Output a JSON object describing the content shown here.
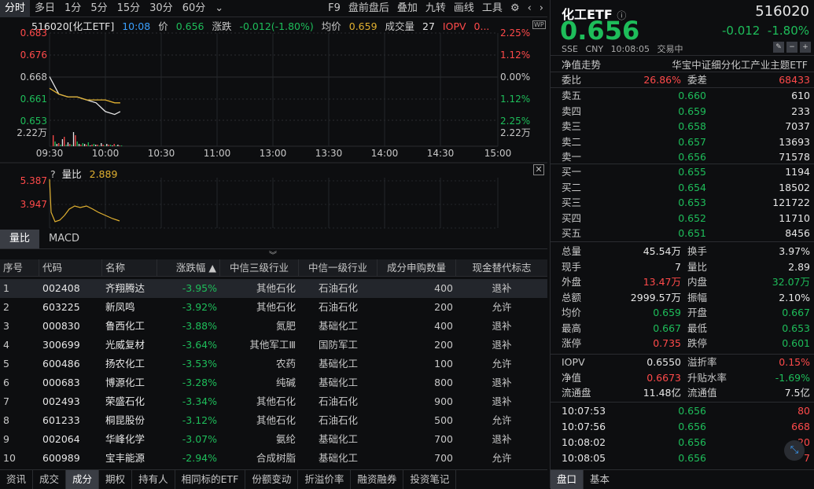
{
  "toolbar": {
    "timeframes": [
      "分时",
      "多日",
      "1分",
      "5分",
      "15分",
      "30分",
      "60分"
    ],
    "more": "⌄",
    "tools": [
      "F9",
      "盘前盘后",
      "叠加",
      "九转",
      "画线",
      "工具"
    ]
  },
  "quote_line": {
    "name": "516020[化工ETF]",
    "time": "10:08",
    "price_label": "价",
    "price": "0.656",
    "chg_label": "涨跌",
    "chg": "-0.012(-1.80%)",
    "avg_label": "均价",
    "avg": "0.659",
    "vol_label": "成交量",
    "vol": "27",
    "iopv_label": "IOPV",
    "iopv": "0..."
  },
  "price_axis": {
    "left": [
      "0.683",
      "0.676",
      "0.668",
      "0.661",
      "0.653",
      "2.22万"
    ],
    "right": [
      "2.25%",
      "1.12%",
      "0.00%",
      "1.12%",
      "2.25%",
      "2.22万"
    ]
  },
  "time_axis": [
    "09:30",
    "10:00",
    "10:30",
    "11:00",
    "13:00",
    "13:30",
    "14:00",
    "14:30",
    "15:00"
  ],
  "sub": {
    "help": "?",
    "name": "量比",
    "value": "2.889",
    "axis": [
      "5.387",
      "3.947"
    ]
  },
  "panel_tabs": [
    "量比",
    "MACD"
  ],
  "table": {
    "headers": [
      "序号",
      "代码",
      "名称",
      "涨跌幅",
      "中信三级行业",
      "中信一级行业",
      "成分申购数量",
      "现金替代标志"
    ],
    "rows": [
      [
        "1",
        "002408",
        "齐翔腾达",
        "-3.95%",
        "其他石化",
        "石油石化",
        "400",
        "退补"
      ],
      [
        "2",
        "603225",
        "新凤鸣",
        "-3.92%",
        "其他石化",
        "石油石化",
        "200",
        "允许"
      ],
      [
        "3",
        "000830",
        "鲁西化工",
        "-3.88%",
        "氮肥",
        "基础化工",
        "400",
        "退补"
      ],
      [
        "4",
        "300699",
        "光威复材",
        "-3.64%",
        "其他军工Ⅲ",
        "国防军工",
        "200",
        "退补"
      ],
      [
        "5",
        "600486",
        "扬农化工",
        "-3.53%",
        "农药",
        "基础化工",
        "100",
        "允许"
      ],
      [
        "6",
        "000683",
        "博源化工",
        "-3.28%",
        "纯碱",
        "基础化工",
        "800",
        "退补"
      ],
      [
        "7",
        "002493",
        "荣盛石化",
        "-3.34%",
        "其他石化",
        "石油石化",
        "900",
        "退补"
      ],
      [
        "8",
        "601233",
        "桐昆股份",
        "-3.12%",
        "其他石化",
        "石油石化",
        "500",
        "允许"
      ],
      [
        "9",
        "002064",
        "华峰化学",
        "-3.07%",
        "氨纶",
        "基础化工",
        "700",
        "退补"
      ],
      [
        "10",
        "600989",
        "宝丰能源",
        "-2.94%",
        "合成树脂",
        "基础化工",
        "700",
        "允许"
      ]
    ]
  },
  "bottom_tabs": [
    "资讯",
    "成交",
    "成分",
    "期权",
    "持有人",
    "相同标的ETF",
    "份额变动",
    "折溢价率",
    "融资融券",
    "投资笔记"
  ],
  "right": {
    "name": "化工ETF",
    "code": "516020",
    "price": "0.656",
    "chg": "-0.012",
    "pct": "-1.80%",
    "meta": [
      "SSE",
      "CNY",
      "10:08:05",
      "交易中"
    ],
    "nav_trend": "净值走势",
    "full_name": "华宝中证细分化工产业主题ETF",
    "wb": {
      "l1": "委比",
      "v1": "26.86%",
      "l2": "委差",
      "v2": "68433"
    },
    "asks": [
      [
        "卖五",
        "0.660",
        "610"
      ],
      [
        "卖四",
        "0.659",
        "233"
      ],
      [
        "卖三",
        "0.658",
        "7037"
      ],
      [
        "卖二",
        "0.657",
        "13693"
      ],
      [
        "卖一",
        "0.656",
        "71578"
      ]
    ],
    "bids": [
      [
        "买一",
        "0.655",
        "1194"
      ],
      [
        "买二",
        "0.654",
        "18502"
      ],
      [
        "买三",
        "0.653",
        "121722"
      ],
      [
        "买四",
        "0.652",
        "11710"
      ],
      [
        "买五",
        "0.651",
        "8456"
      ]
    ],
    "stats": [
      [
        "总量",
        "45.54万",
        "换手",
        "3.97%"
      ],
      [
        "现手",
        "7",
        "量比",
        "2.89"
      ],
      [
        "外盘",
        "13.47万",
        "内盘",
        "32.07万"
      ],
      [
        "总额",
        "2999.57万",
        "振幅",
        "2.10%"
      ],
      [
        "均价",
        "0.659",
        "开盘",
        "0.667"
      ],
      [
        "最高",
        "0.667",
        "最低",
        "0.653"
      ],
      [
        "涨停",
        "0.735",
        "跌停",
        "0.601"
      ]
    ],
    "iopv": [
      [
        "IOPV",
        "0.6550",
        "溢折率",
        "0.15%"
      ],
      [
        "净值",
        "0.6673",
        "升贴水率",
        "-1.69%"
      ],
      [
        "流通盘",
        "11.48亿",
        "流通值",
        "7.5亿"
      ]
    ],
    "ticks": [
      [
        "10:07:53",
        "0.656",
        "80"
      ],
      [
        "10:07:56",
        "0.656",
        "668"
      ],
      [
        "10:08:02",
        "0.656",
        "20"
      ],
      [
        "10:08:05",
        "0.656",
        "7"
      ]
    ],
    "tabs": [
      "盘口",
      "基本"
    ]
  },
  "chart_data": {
    "type": "line",
    "title": "516020[化工ETF]",
    "x": [
      "09:30",
      "09:35",
      "09:40",
      "09:45",
      "09:50",
      "09:55",
      "10:00",
      "10:05",
      "10:08"
    ],
    "series": [
      {
        "name": "价",
        "values": [
          0.668,
          0.662,
          0.661,
          0.661,
          0.66,
          0.659,
          0.656,
          0.655,
          0.656
        ]
      },
      {
        "name": "均价",
        "values": [
          0.664,
          0.662,
          0.661,
          0.661,
          0.66,
          0.66,
          0.66,
          0.659,
          0.659
        ]
      }
    ],
    "ylim": [
      0.653,
      0.683
    ]
  }
}
